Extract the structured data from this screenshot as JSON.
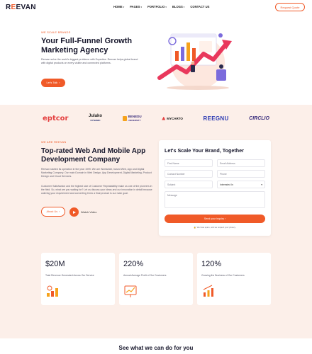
{
  "header": {
    "logo_prefix": "R",
    "logo_o": "E",
    "logo_suffix": "EVAN",
    "nav": [
      "HOME",
      "PAGES",
      "PORTFOLIO",
      "BLOGS",
      "CONTACT US"
    ],
    "quote_button": "Request Quote"
  },
  "hero": {
    "eyebrow": "WE SCALE BRANDS",
    "title": "Your Full-Funnel Growth Marketing Agency",
    "description": "Reevan solve the world's biggest problems with Expertise. Reevan helps global brand with digital products on every visible and connected platforms.",
    "cta": "Let's Talk"
  },
  "brands": [
    "eptcor",
    "Julako",
    "BENEDU",
    "MYCARTO",
    "REEGNU",
    "CIRCLIO"
  ],
  "brand_subs": {
    "julako": "DYNAMIC",
    "benedu": "UNIVERSITY"
  },
  "about": {
    "eyebrow": "WE ARE REEVAN",
    "title": "Top-rated Web And Mobile App Development Company",
    "para1": "Reevan started its operation in the year 1999. We are Worldwide, based Web, App and Digital Marketing Company. Our main Domain in Web Design, App Development, Digital Marketing, Product Design and Cloud Services.",
    "para2": "Customer Satisfaction and the highest size of Customer Repeatability make us one of the pioneers in the field. So, what are you waiting for? Let us discuss your ideas and our innovation in detail because catering your requirement and converting it into a final product is our main goal.",
    "about_button": "About Us",
    "watch_label": "Watch Video"
  },
  "form": {
    "title": "Let's Scale Your Brand, Together",
    "first_name": "First Name",
    "email": "Email Address",
    "company": "Contact Number",
    "phone": "Phone",
    "subject": "Subject",
    "interest": "Interested In",
    "message": "Message",
    "submit": "Send your inquiry",
    "privacy": "We hate spam, and we respect your privacy."
  },
  "stats": [
    {
      "value": "$20M",
      "label": "Total Revenue Generated Across Our Service",
      "icon": "money-growth-icon"
    },
    {
      "value": "220%",
      "label": "Annual Average Profit of Our Customers",
      "icon": "profit-chart-icon"
    },
    {
      "value": "120%",
      "label": "Growing the Business of Our Customers",
      "icon": "business-growth-icon"
    }
  ],
  "services": {
    "title": "See what we can do for you"
  },
  "colors": {
    "accent": "#f05a28",
    "band": "#fcefe9",
    "heading": "#16162b"
  }
}
